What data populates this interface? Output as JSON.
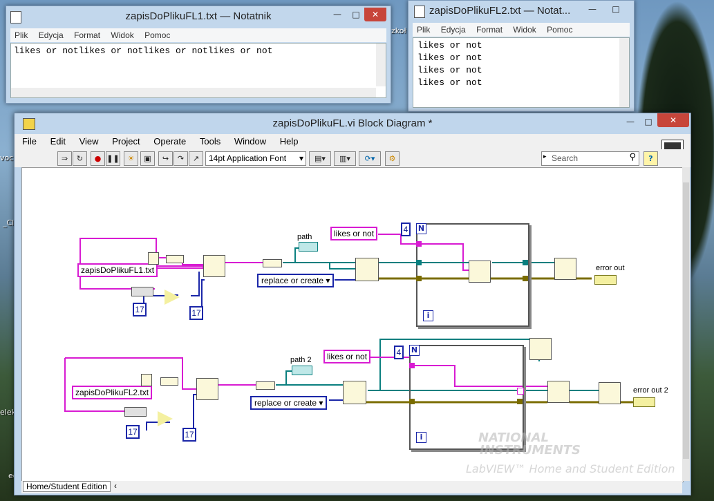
{
  "desktop": {
    "labels": [
      "zkoł",
      "voc",
      "_Cl",
      "elekt",
      "ec"
    ]
  },
  "notepad1": {
    "title": "zapisDoPlikuFL1.txt — Notatnik",
    "menu": [
      "Plik",
      "Edycja",
      "Format",
      "Widok",
      "Pomoc"
    ],
    "lines": [
      "likes or notlikes or notlikes or notlikes or not"
    ]
  },
  "notepad2": {
    "title": "zapisDoPlikuFL2.txt — Notat...",
    "menu": [
      "Plik",
      "Edycja",
      "Format",
      "Widok",
      "Pomoc"
    ],
    "lines": [
      "likes or not",
      "likes or not",
      "likes or not",
      "likes or not"
    ]
  },
  "labview": {
    "title": "zapisDoPlikuFL.vi Block Diagram *",
    "menu": [
      "File",
      "Edit",
      "View",
      "Project",
      "Operate",
      "Tools",
      "Window",
      "Help"
    ],
    "font_select": "14pt Application Font",
    "search_placeholder": "Search",
    "status_text": "Home/Student Edition",
    "watermark_line1": "NATIONAL",
    "watermark_line2": "INSTRUMENTS",
    "watermark_line3": "LabVIEW™ Home and Student Edition",
    "diagram1": {
      "filename": "zapisDoPlikuFL1.txt",
      "num_a": "17",
      "num_b": "17",
      "path_label": "path",
      "mode": "replace or create",
      "string": "likes or not",
      "loop_count": "4",
      "loop_n": "N",
      "loop_i": "i",
      "error_label": "error out"
    },
    "diagram2": {
      "filename": "zapisDoPlikuFL2.txt",
      "num_a": "17",
      "num_b": "17",
      "path_label": "path 2",
      "mode": "replace or create",
      "string": "likes or not",
      "loop_count": "4",
      "loop_n": "N",
      "loop_i": "i",
      "error_label": "error out 2"
    }
  },
  "colors": {
    "string_wire": "#d81bd2",
    "path_wire": "#0a7f7f",
    "error_wire": "#7a6c00",
    "numeric_wire": "#1a26a8"
  }
}
